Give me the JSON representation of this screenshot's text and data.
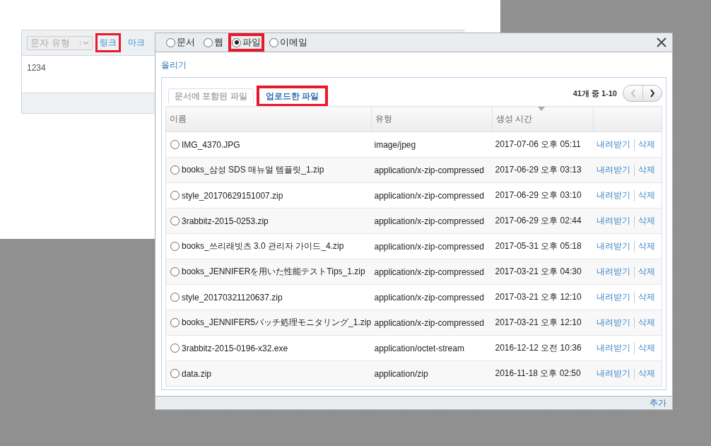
{
  "editor": {
    "toolbar": {
      "select": {
        "placeholder": "문자 유형",
        "disabled": true
      },
      "buttons": [
        {
          "label": "링크",
          "highlighted": true
        },
        {
          "label": "마크",
          "highlighted": false
        }
      ]
    },
    "content": "1234"
  },
  "dialog": {
    "source_options": [
      {
        "label": "문서",
        "selected": false,
        "highlighted": false
      },
      {
        "label": "웹",
        "selected": false,
        "highlighted": false
      },
      {
        "label": "파일",
        "selected": true,
        "highlighted": true
      },
      {
        "label": "이메일",
        "selected": false,
        "highlighted": false
      }
    ],
    "upload_link": "올리기",
    "tabs": [
      {
        "label": "문서에 포함된 파일",
        "selected": false,
        "highlighted": false
      },
      {
        "label": "업로드한 파일",
        "selected": true,
        "highlighted": true
      }
    ],
    "pager": {
      "summary": "41개 중 1-10",
      "prev_disabled": true,
      "next_disabled": false
    },
    "table": {
      "columns": [
        {
          "label": "이름",
          "sorted": false
        },
        {
          "label": "유형",
          "sorted": false
        },
        {
          "label": "생성 시간",
          "sorted": true
        },
        {
          "sorted": false
        }
      ],
      "rows": [
        {
          "name": "IMG_4370.JPG",
          "type": "image/jpeg",
          "created": "2017-07-06 오후 05:11",
          "download": "내려받기",
          "delete": "삭제",
          "selected": false
        },
        {
          "name": "books_삼성 SDS 매뉴얼 템플릿_1.zip",
          "type": "application/x-zip-compressed",
          "created": "2017-06-29 오후 03:13",
          "download": "내려받기",
          "delete": "삭제",
          "selected": false
        },
        {
          "name": "style_20170629151007.zip",
          "type": "application/x-zip-compressed",
          "created": "2017-06-29 오후 03:10",
          "download": "내려받기",
          "delete": "삭제",
          "selected": false
        },
        {
          "name": "3rabbitz-2015-0253.zip",
          "type": "application/x-zip-compressed",
          "created": "2017-06-29 오후 02:44",
          "download": "내려받기",
          "delete": "삭제",
          "selected": false
        },
        {
          "name": "books_쓰리래빗츠 3.0 관리자 가이드_4.zip",
          "type": "application/x-zip-compressed",
          "created": "2017-05-31 오후 05:18",
          "download": "내려받기",
          "delete": "삭제",
          "selected": false
        },
        {
          "name": "books_JENNIFERを用いた性能テストTips_1.zip",
          "type": "application/x-zip-compressed",
          "created": "2017-03-21 오후 04:30",
          "download": "내려받기",
          "delete": "삭제",
          "selected": false
        },
        {
          "name": "style_20170321120637.zip",
          "type": "application/x-zip-compressed",
          "created": "2017-03-21 오후 12:10",
          "download": "내려받기",
          "delete": "삭제",
          "selected": false
        },
        {
          "name": "books_JENNIFER5バッチ処理モニタリング_1.zip",
          "type": "application/x-zip-compressed",
          "created": "2017-03-21 오후 12:10",
          "download": "내려받기",
          "delete": "삭제",
          "selected": false
        },
        {
          "name": "3rabbitz-2015-0196-x32.exe",
          "type": "application/octet-stream",
          "created": "2016-12-12 오전 10:36",
          "download": "내려받기",
          "delete": "삭제",
          "selected": false
        },
        {
          "name": "data.zip",
          "type": "application/zip",
          "created": "2016-11-18 오후 02:50",
          "download": "내려받기",
          "delete": "삭제",
          "selected": false
        }
      ]
    },
    "footer_button": "추가"
  }
}
